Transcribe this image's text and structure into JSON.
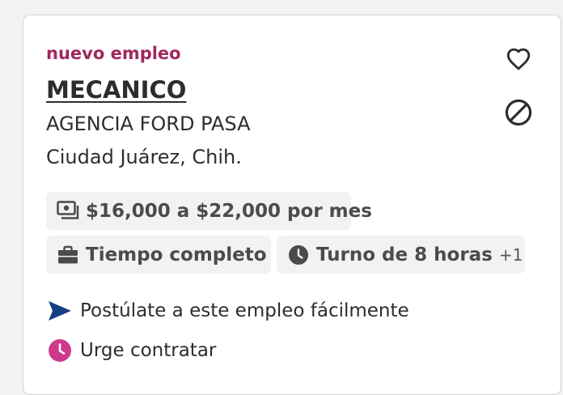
{
  "job": {
    "new_tag": "nuevo empleo",
    "title": "MECANICO",
    "company": "AGENCIA FORD PASA",
    "location": "Ciudad Juárez, Chih.",
    "salary": "$16,000 a $22,000 por mes",
    "job_type": "Tiempo completo",
    "shift": "Turno de 8 horas",
    "shift_more": "+1",
    "easy_apply": "Postúlate a este empleo fácilmente",
    "urgent": "Urge contratar"
  },
  "icons": {
    "save": "heart-icon",
    "hide": "not-interested-icon",
    "salary": "money-icon",
    "job_type": "briefcase-icon",
    "shift": "clock-icon",
    "easy_apply": "send-icon",
    "urgent": "clock-icon"
  },
  "colors": {
    "new_tag": "#a0285e",
    "text": "#2d2d2d",
    "chip_bg": "#f3f2f1",
    "chip_text": "#4b4b4b",
    "apply_icon": "#164081",
    "urgent_icon": "#cd3a8c"
  }
}
